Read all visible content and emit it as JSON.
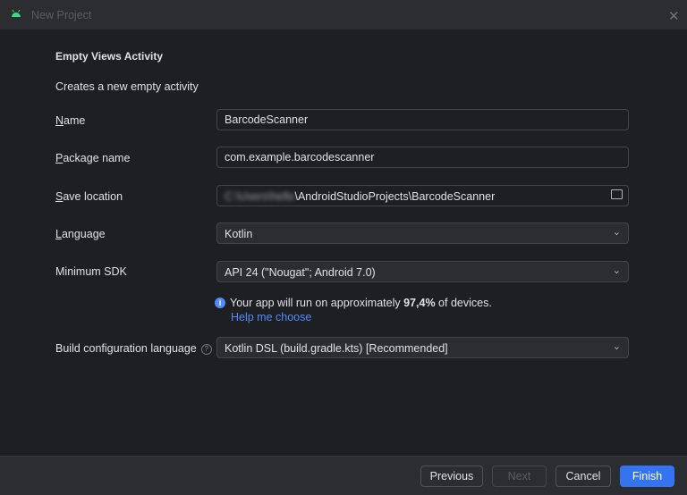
{
  "window": {
    "title": "New Project"
  },
  "template": {
    "title": "Empty Views Activity",
    "description": "Creates a new empty activity"
  },
  "form": {
    "name": {
      "label_first": "N",
      "label_rest": "ame",
      "value": "BarcodeScanner"
    },
    "package": {
      "label_first": "P",
      "label_rest": "ackage name",
      "value": "com.example.barcodescanner"
    },
    "save_location": {
      "label_first": "S",
      "label_rest": "ave location",
      "value_blurred": "C:\\Users\\hello",
      "value": "\\AndroidStudioProjects\\BarcodeScanner"
    },
    "language": {
      "label_first": "L",
      "label_rest": "anguage",
      "value": "Kotlin"
    },
    "min_sdk": {
      "label": "Minimum SDK",
      "value": "API 24 (\"Nougat\"; Android 7.0)"
    },
    "sdk_info": {
      "prefix": "Your app will run on approximately",
      "percent": "97,4%",
      "suffix": "of devices.",
      "link": "Help me choose"
    },
    "build_config": {
      "label": "Build configuration language",
      "help": "?",
      "value": "Kotlin DSL (build.gradle.kts) [Recommended]"
    }
  },
  "footer": {
    "previous": "Previous",
    "next": "Next",
    "cancel": "Cancel",
    "finish": "Finish"
  }
}
